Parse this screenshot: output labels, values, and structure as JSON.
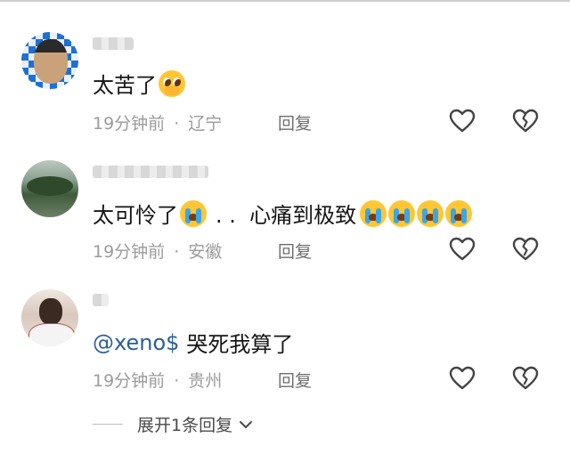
{
  "comments": [
    {
      "text": "太苦了",
      "emoji": [
        "pleading-face-emoji"
      ],
      "time": "19分钟前",
      "location": "辽宁",
      "reply_label": "回复"
    },
    {
      "text": "太可怜了",
      "text_after": ". .  心痛到极致",
      "emoji_after": [
        "crying-face-emoji"
      ],
      "emoji_end": [
        "crying-face-emoji",
        "crying-face-emoji",
        "crying-face-emoji",
        "crying-face-emoji"
      ],
      "time": "19分钟前",
      "location": "安徽",
      "reply_label": "回复"
    },
    {
      "mention": "@xeno$",
      "text": "哭死我算了",
      "time": "19分钟前",
      "location": "贵州",
      "reply_label": "回复"
    }
  ],
  "meta_separator": "·",
  "expand_replies": "展开1条回复",
  "colors": {
    "mention": "#2b5f95",
    "text": "#161616",
    "meta": "#9b9b9b"
  }
}
